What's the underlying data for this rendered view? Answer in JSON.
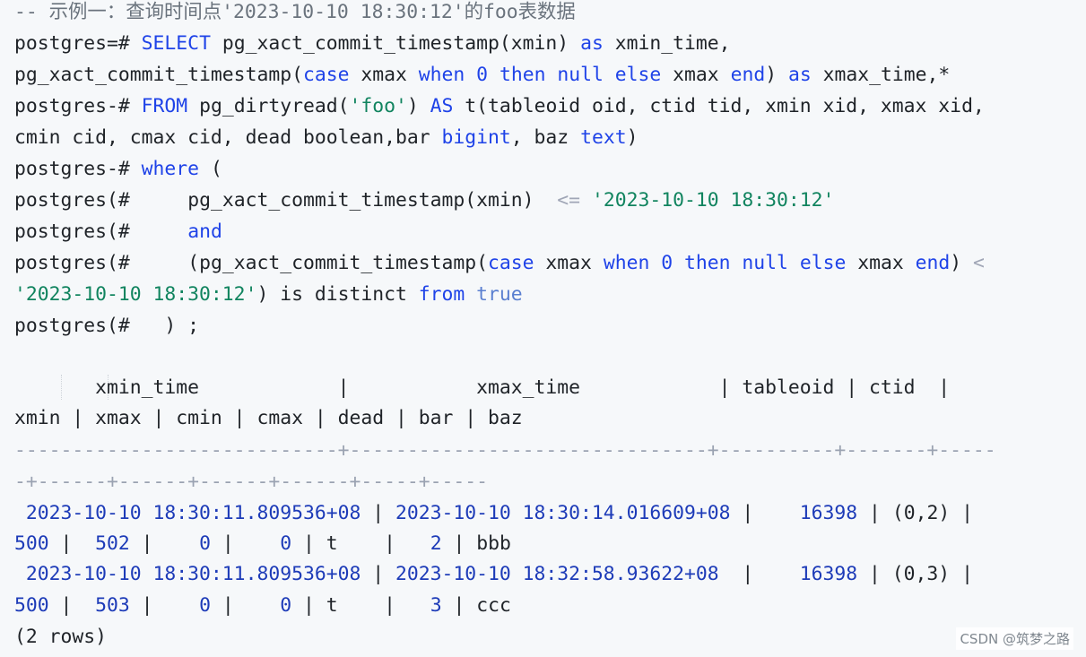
{
  "code": {
    "comment": "-- 示例一：查询时间点'2023-10-10 18:30:12'的foo表数据",
    "l1": {
      "prompt": "postgres=# ",
      "select": "SELECT",
      "p1": " pg_xact_commit_timestamp(xmin) ",
      "as": "as",
      "p2": " xmin_time,"
    },
    "l2": {
      "p1": "pg_xact_commit_timestamp(",
      "case": "case",
      "p2": " xmax ",
      "when": "when",
      "sp1": " ",
      "zero": "0",
      "sp2": " ",
      "then": "then",
      "sp3": " ",
      "null": "null",
      "sp4": " ",
      "else": "else",
      "p3": " xmax ",
      "end": "end",
      "p4": ") ",
      "as": "as",
      "p5": " xmax_time,*"
    },
    "l3": {
      "prompt": "postgres-# ",
      "from": "FROM",
      "p1": " pg_dirtyread(",
      "str": "'foo'",
      "p2": ") ",
      "as": "AS",
      "p3": " t(tableoid oid, ctid tid, xmin xid, xmax xid,"
    },
    "l4": {
      "p1": "cmin cid, cmax cid, dead boolean,bar ",
      "bigint": "bigint",
      "p2": ", baz ",
      "text": "text",
      "p3": ")"
    },
    "l5": {
      "prompt": "postgres-# ",
      "where": "where",
      "p1": " ("
    },
    "l6": {
      "prompt": "postgres(#     ",
      "p1": "pg_xact_commit_timestamp(xmin)  ",
      "op": "<=",
      "sp": " ",
      "str": "'2023-10-10 18:30:12'"
    },
    "l7": {
      "prompt": "postgres(#     ",
      "and": "and"
    },
    "l8": {
      "prompt": "postgres(#     ",
      "p1": "(pg_xact_commit_timestamp(",
      "case": "case",
      "p2": " xmax ",
      "when": "when",
      "sp1": " ",
      "zero": "0",
      "sp2": " ",
      "then": "then",
      "sp3": " ",
      "null": "null",
      "sp4": " ",
      "else": "else",
      "p3": " xmax ",
      "end": "end",
      "p4": ") ",
      "op": "<"
    },
    "l9": {
      "str": "'2023-10-10 18:30:12'",
      "p1": ") is distinct ",
      "from": "from",
      "sp": " ",
      "true": "true"
    },
    "l10": {
      "text": "postgres(#   ) ;"
    }
  },
  "result": {
    "header_line1": "       xmin_time            |           xmax_time            | tableoid | ctid  |",
    "header_line2": "xmin | xmax | cmin | cmax | dead | bar | baz",
    "separator_line1": "----------------------------+-------------------------------+----------+-------+-----",
    "separator_line2": "-+------+------+------+------+-----+-----",
    "rows": [
      {
        "line1_time1": " 2023-10-10 18:30:11.809536+08",
        "line1_sep1": " | ",
        "line1_time2": "2023-10-10 18:30:14.016609+08",
        "line1_sep2": " |    ",
        "line1_tableoid": "16398",
        "line1_sep3": " | ",
        "line1_ctid": "(0,2)",
        "line1_sep4": " |",
        "line2_xmin": "500",
        "line2_sep1": " |  ",
        "line2_xmax": "502",
        "line2_sep2": " |    ",
        "line2_cmin": "0",
        "line2_sep3": " |    ",
        "line2_cmax": "0",
        "line2_sep4": " | ",
        "line2_dead": "t",
        "line2_sep5": "    |   ",
        "line2_bar": "2",
        "line2_sep6": " | ",
        "line2_baz": "bbb"
      },
      {
        "line1_time1": " 2023-10-10 18:30:11.809536+08",
        "line1_sep1": " | ",
        "line1_time2": "2023-10-10 18:32:58.93622+08",
        "line1_sep2": "  |    ",
        "line1_tableoid": "16398",
        "line1_sep3": " | ",
        "line1_ctid": "(0,3)",
        "line1_sep4": " |",
        "line2_xmin": "500",
        "line2_sep1": " |  ",
        "line2_xmax": "503",
        "line2_sep2": " |    ",
        "line2_cmin": "0",
        "line2_sep3": " |    ",
        "line2_cmax": "0",
        "line2_sep4": " | ",
        "line2_dead": "t",
        "line2_sep5": "    |   ",
        "line2_bar": "3",
        "line2_sep6": " | ",
        "line2_baz": "ccc"
      }
    ],
    "row_count": "(2 rows)"
  },
  "watermark": "CSDN @筑梦之路",
  "colors": {
    "background": "#f6f8fa",
    "keyword": "#1f43e8",
    "string": "#11845f",
    "comment": "#6a737d",
    "text": "#1f2328"
  }
}
